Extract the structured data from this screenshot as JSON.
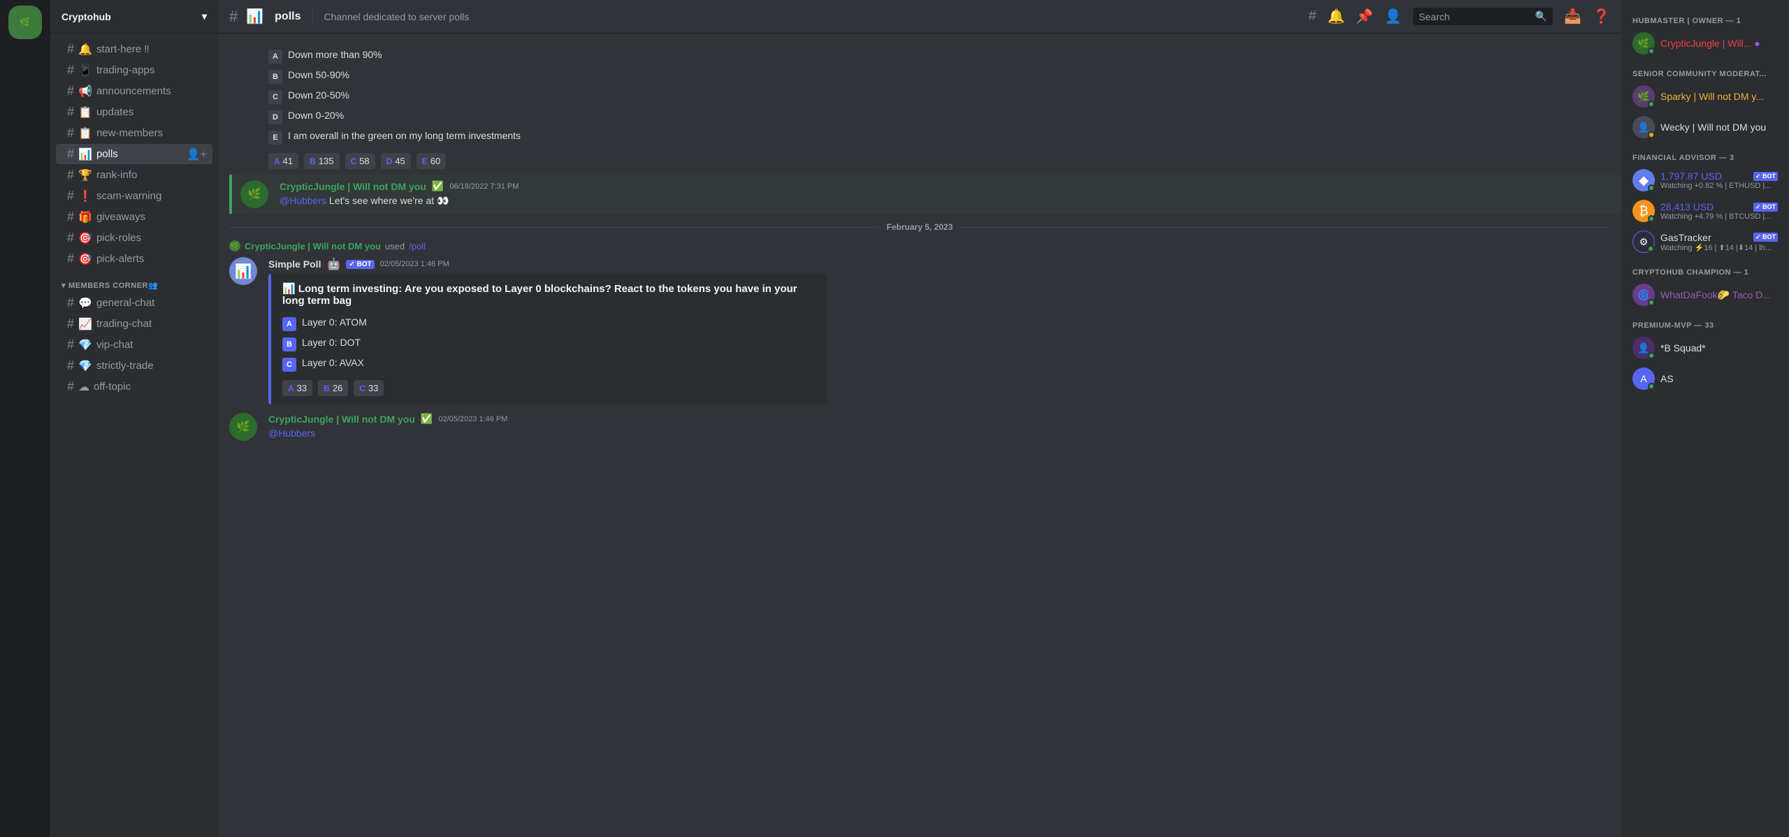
{
  "server": {
    "name": "Cryptohub",
    "icon": "C"
  },
  "channel_sidebar": {
    "server_name": "Cryptohub",
    "channels": [
      {
        "id": "start-here",
        "name": "start-here",
        "icon": "🔔",
        "suffix": "‼"
      },
      {
        "id": "trading-apps",
        "name": "trading-apps",
        "icon": "📱"
      },
      {
        "id": "announcements",
        "name": "announcements",
        "icon": "📢"
      },
      {
        "id": "updates",
        "name": "updates",
        "icon": "📋"
      },
      {
        "id": "new-members",
        "name": "new-members",
        "icon": "📋"
      },
      {
        "id": "polls",
        "name": "polls",
        "icon": "📊",
        "active": true
      },
      {
        "id": "rank-info",
        "name": "rank-info",
        "icon": "🏆"
      },
      {
        "id": "scam-warning",
        "name": "scam-warning",
        "icon": "❗"
      },
      {
        "id": "giveaways",
        "name": "giveaways",
        "icon": "🎁"
      },
      {
        "id": "pick-roles",
        "name": "pick-roles",
        "icon": "🎯"
      },
      {
        "id": "pick-alerts",
        "name": "pick-alerts",
        "icon": "🎯"
      }
    ],
    "section_members_corner": "MEMBERS CORNER👥",
    "members_corner_channels": [
      {
        "id": "general-chat",
        "name": "general-chat",
        "icon": "💬"
      },
      {
        "id": "trading-chat",
        "name": "trading-chat",
        "icon": "📈"
      },
      {
        "id": "vip-chat",
        "name": "vip-chat",
        "icon": "💎"
      },
      {
        "id": "strictly-trade",
        "name": "strictly-trade",
        "icon": "💎"
      },
      {
        "id": "off-topic",
        "name": "off-topic",
        "icon": "☁"
      }
    ]
  },
  "top_bar": {
    "channel_name": "polls",
    "channel_desc": "Channel dedicated to server polls",
    "search_placeholder": "Search"
  },
  "messages": [
    {
      "id": "poll1",
      "type": "poll_result",
      "options": [
        {
          "letter": "A",
          "text": "Down more than 90%"
        },
        {
          "letter": "B",
          "text": "Down 50-90%"
        },
        {
          "letter": "C",
          "text": "Down 20-50%"
        },
        {
          "letter": "D",
          "text": "Down 0-20%"
        },
        {
          "letter": "E",
          "text": "I am overall in the green on my long term investments"
        }
      ],
      "votes": [
        {
          "letter": "A",
          "count": "41"
        },
        {
          "letter": "B",
          "count": "135"
        },
        {
          "letter": "C",
          "count": "58"
        },
        {
          "letter": "D",
          "count": "45"
        },
        {
          "letter": "E",
          "count": "60"
        }
      ]
    },
    {
      "id": "msg1",
      "type": "user_message",
      "username": "CrypticJungle | Will not DM you",
      "verified": true,
      "timestamp": "06/18/2022 7:31 PM",
      "content": "@Hubbers Let's see where we're at 👀"
    },
    {
      "id": "divider1",
      "type": "date_divider",
      "date": "February 5, 2023"
    },
    {
      "id": "slash1",
      "type": "slash_used",
      "username": "CrypticJungle | Will not DM you",
      "command": "/poll"
    },
    {
      "id": "poll2",
      "type": "bot_poll",
      "bot_name": "Simple Poll",
      "timestamp": "02/05/2023 1:46 PM",
      "poll_title": "Long term investing: Are you exposed to Layer 0 blockchains? React to the tokens you have in your long term bag",
      "options": [
        {
          "letter": "A",
          "text": "Layer 0: ATOM"
        },
        {
          "letter": "B",
          "text": "Layer 0: DOT"
        },
        {
          "letter": "C",
          "text": "Layer 0: AVAX"
        }
      ],
      "votes": [
        {
          "letter": "A",
          "count": "33"
        },
        {
          "letter": "B",
          "count": "26"
        },
        {
          "letter": "C",
          "count": "33"
        }
      ]
    },
    {
      "id": "msg2",
      "type": "user_message_simple",
      "username": "CrypticJungle | Will not DM you",
      "verified": true,
      "timestamp": "02/05/2023 1:46 PM",
      "mention": "@Hubbers"
    }
  ],
  "members_panel": {
    "sections": [
      {
        "title": "HUBMASTER | OWNER — 1",
        "members": [
          {
            "name": "CrypticJungle | Will...",
            "role": "owner",
            "status": "online",
            "has_purple_dot": true
          }
        ]
      },
      {
        "title": "SENIOR COMMUNITY MODERAT...",
        "members": [
          {
            "name": "Sparky | Will not DM y...",
            "role": "mod",
            "status": "online"
          },
          {
            "name": "Wecky | Will not DM you",
            "role": "default",
            "status": "idle"
          }
        ]
      },
      {
        "title": "FINANCIAL ADVISOR — 3",
        "members": [
          {
            "name": "1,797.87 USD",
            "role": "advisor",
            "status": "online",
            "is_bot": true,
            "sub": "Watching +0.82 % | ETHUSD |..."
          },
          {
            "name": "28,413 USD",
            "role": "advisor",
            "status": "online",
            "is_bot": true,
            "sub": "Watching +4.79 % | BTCUSD |..."
          },
          {
            "name": "GasTracker",
            "role": "default",
            "status": "online",
            "is_bot": true,
            "sub": "Watching ⚡16 | ⬆14 |⬇14 | lh..."
          }
        ]
      },
      {
        "title": "CRYPTOHUB CHAMPION — 1",
        "members": [
          {
            "name": "WhatDaFook🌮 Taco D...",
            "role": "premium",
            "status": "online"
          }
        ]
      },
      {
        "title": "PREMIUM-MVP — 33",
        "members": [
          {
            "name": "*B Squad*",
            "role": "default",
            "status": "online"
          },
          {
            "name": "AS",
            "role": "default",
            "status": "online"
          }
        ]
      }
    ]
  }
}
